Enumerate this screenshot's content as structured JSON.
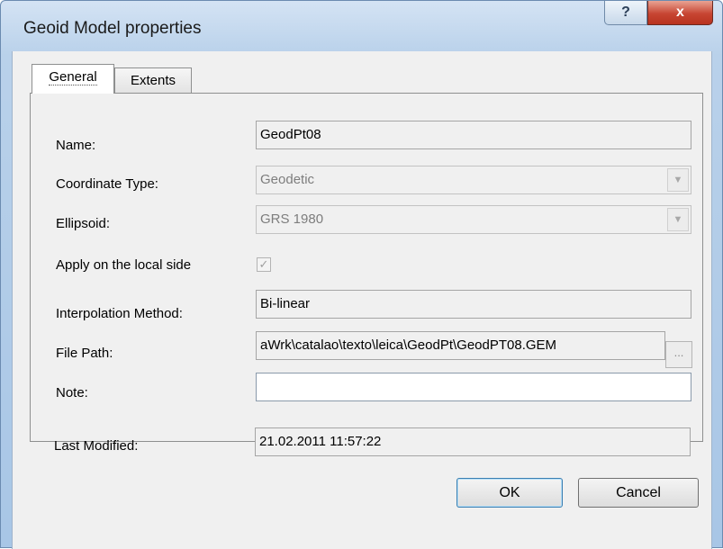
{
  "window": {
    "title": "Geoid Model properties",
    "help_label": "?",
    "close_label": "x"
  },
  "tabs": [
    {
      "label": "General"
    },
    {
      "label": "Extents"
    }
  ],
  "fields": {
    "name": {
      "label": "Name:",
      "value": "GeodPt08"
    },
    "coordinate_type": {
      "label": "Coordinate Type:",
      "value": "Geodetic"
    },
    "ellipsoid": {
      "label": "Ellipsoid:",
      "value": "GRS 1980"
    },
    "apply_local": {
      "label": "Apply on the local side",
      "checked": true
    },
    "interpolation": {
      "label": "Interpolation Method:",
      "value": "Bi-linear"
    },
    "file_path": {
      "label": "File Path:",
      "value": "aWrk\\catalao\\texto\\leica\\GeodPt\\GeodPT08.GEM",
      "browse_label": "..."
    },
    "note": {
      "label": "Note:",
      "value": ""
    },
    "last_modified": {
      "label": "Last Modified:",
      "value": "21.02.2011 11:57:22"
    }
  },
  "buttons": {
    "ok": "OK",
    "cancel": "Cancel"
  },
  "icons": {
    "dropdown": "chevron-down-icon",
    "check": "checkmark-icon"
  }
}
